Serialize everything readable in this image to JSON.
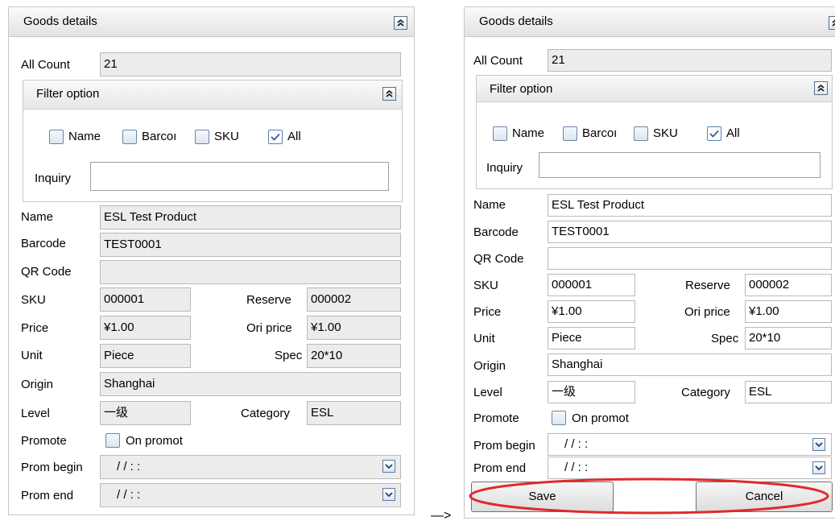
{
  "panel": {
    "title": "Goods details",
    "all_count_label": "All Count",
    "all_count_value": "21",
    "filter": {
      "title": "Filter option",
      "name_label": "Name",
      "barcode_label": "Barcoı",
      "sku_label": "SKU",
      "all_label": "All",
      "inquiry_label": "Inquiry",
      "inquiry_value": ""
    },
    "fields": {
      "name_label": "Name",
      "name_value": "ESL Test Product",
      "barcode_label": "Barcode",
      "barcode_value": "TEST0001",
      "qr_label": "QR Code",
      "qr_value": "",
      "sku_label": "SKU",
      "sku_value": "000001",
      "reserve_label": "Reserve",
      "reserve_value": "000002",
      "price_label": "Price",
      "price_value": "¥1.00",
      "ori_price_label": "Ori price",
      "ori_price_value": "¥1.00",
      "unit_label": "Unit",
      "unit_value": "Piece",
      "spec_label": "Spec",
      "spec_value": "20*10",
      "origin_label": "Origin",
      "origin_value": "Shanghai",
      "level_label": "Level",
      "level_value": "一级",
      "category_label": "Category",
      "category_value": "ESL",
      "promote_label": "Promote",
      "promote_option": "On promot",
      "prom_begin_label": "Prom begin",
      "prom_begin_value": "/ /   : :",
      "prom_end_label": "Prom end",
      "prom_end_value": "/ /   : :"
    },
    "buttons": {
      "save": "Save",
      "cancel": "Cancel"
    }
  },
  "arrow_text": "—>",
  "colors": {
    "highlight_ellipse": "#e0292b",
    "readonly_field": "#ececec",
    "border": "#c8c8c8"
  }
}
